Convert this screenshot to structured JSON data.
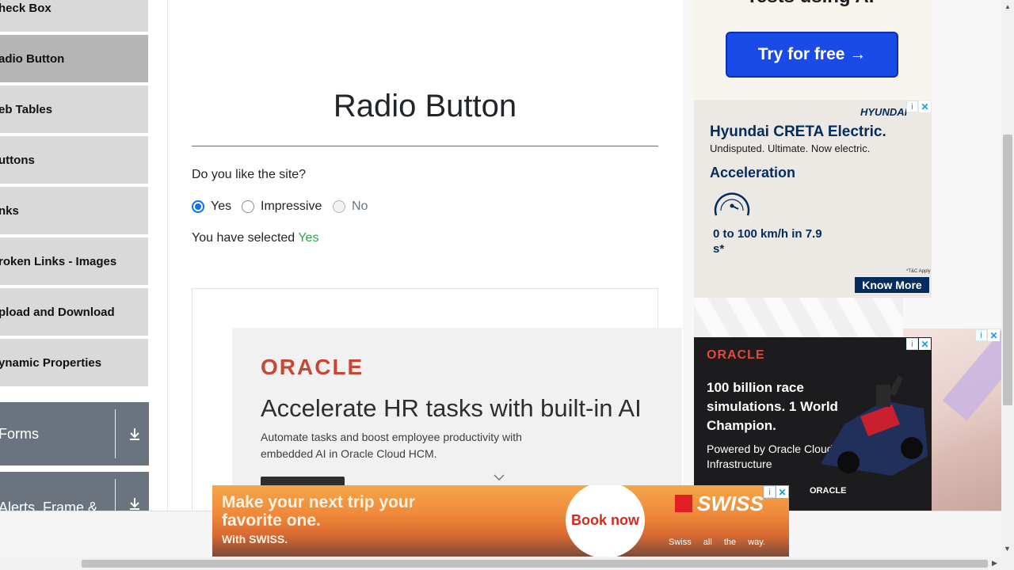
{
  "sidebar": {
    "items": [
      {
        "label": "heck Box"
      },
      {
        "label": "adio Button"
      },
      {
        "label": "eb Tables"
      },
      {
        "label": "uttons"
      },
      {
        "label": "nks"
      },
      {
        "label": "roken Links - Images"
      },
      {
        "label": "pload and Download"
      },
      {
        "label": "ynamic Properties"
      }
    ],
    "groups": [
      {
        "label": "Forms"
      },
      {
        "label": "Alerts, Frame &"
      }
    ]
  },
  "main": {
    "title": "Radio Button",
    "question": "Do you like the site?",
    "options": [
      {
        "label": "Yes",
        "state": "checked"
      },
      {
        "label": "Impressive",
        "state": "unchecked"
      },
      {
        "label": "No",
        "state": "disabled"
      }
    ],
    "result_prefix": "You have selected ",
    "result_value": "Yes"
  },
  "ads": {
    "top": {
      "tagline": "Tests using AI",
      "button": "Try for free →"
    },
    "hyundai": {
      "logo": "HYUNDAI",
      "title": "Hyundai CRETA Electric.",
      "subtitle": "Undisputed. Ultimate. Now electric.",
      "feature": "Acceleration",
      "speed": "0 to 100 km/h in 7.9 s*",
      "tc": "*T&C Apply",
      "button": "Know More"
    },
    "oracle_hr": {
      "logo": "ORACLE",
      "headline": "Accelerate HR tasks with built-in AI",
      "body": "Automate tasks and boost employee productivity with embedded AI in Oracle Cloud HCM."
    },
    "oracle_f1": {
      "logo": "ORACLE",
      "headline": "100 billion race simulations. 1 World Champion.",
      "sub": "Powered by Oracle Cloud Infrastructure",
      "brand": "ORACLE"
    },
    "swiss": {
      "headline": "Make your next trip your favorite one.",
      "sub": "With SWISS.",
      "button": "Book now",
      "logo": "SWISS",
      "tagline": "Swiss all the way."
    }
  },
  "colors": {
    "accent": "#0d6efd",
    "success": "#28a745",
    "sidebar_bg": "#d9d9d9",
    "sidebar_active": "#b5b5b5",
    "group_bg": "#6b747e"
  }
}
